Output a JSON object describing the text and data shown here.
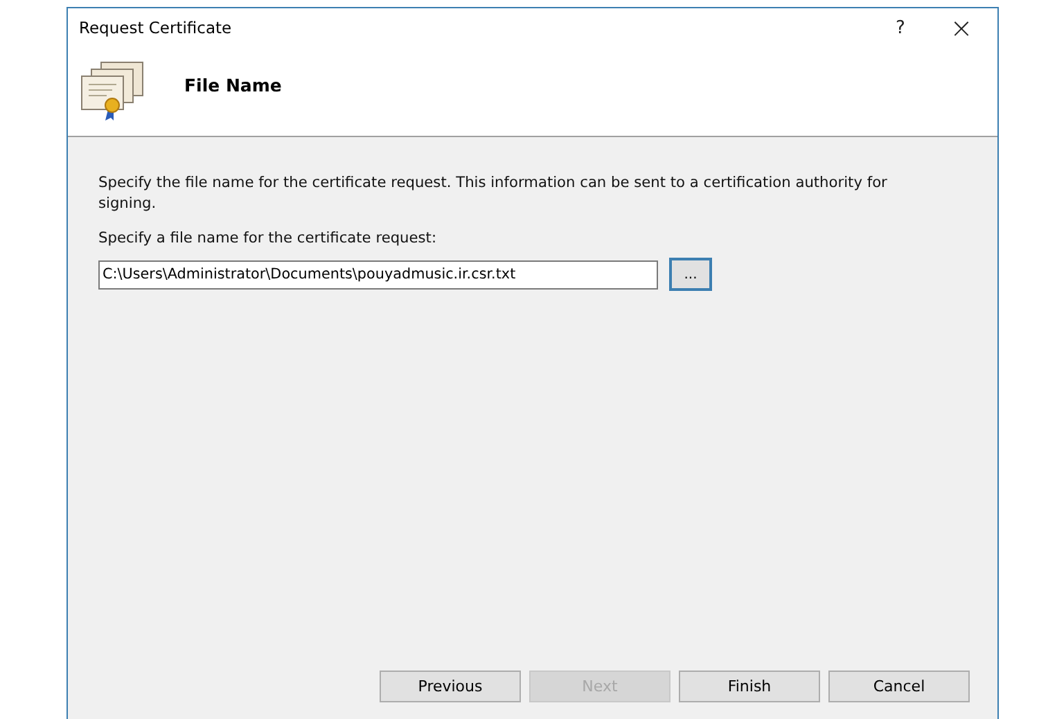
{
  "window": {
    "title": "Request Certificate",
    "help_button": "?",
    "close_button": "×"
  },
  "header": {
    "title": "File Name"
  },
  "description": "Specify the file name for the certificate request. This information can be sent to a certification authority for signing.",
  "file_field": {
    "label": "Specify a file name for the certificate request:",
    "value": "C:\\Users\\Administrator\\Documents\\pouyadmusic.ir.csr.txt",
    "browse_button": "...",
    "browse_focused": true
  },
  "buttons": [
    {
      "label": "Previous",
      "disabled": false
    },
    {
      "label": "Next",
      "disabled": true
    },
    {
      "label": "Finish",
      "disabled": false
    },
    {
      "label": "Cancel",
      "disabled": false
    }
  ]
}
